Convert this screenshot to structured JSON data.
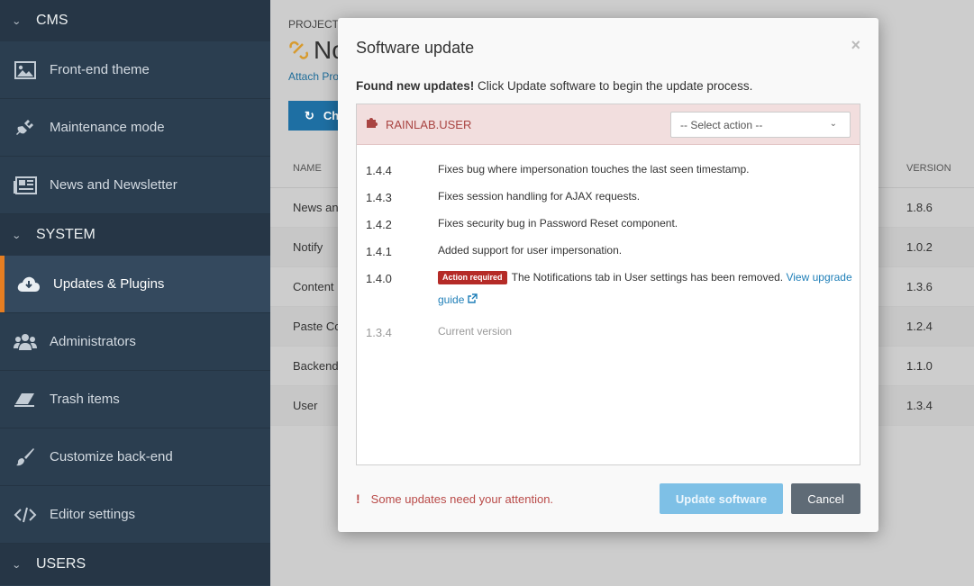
{
  "sidebar": {
    "sections": [
      {
        "title": "CMS"
      },
      {
        "title": "SYSTEM"
      },
      {
        "title": "USERS"
      }
    ],
    "items": [
      {
        "label": "Front-end theme",
        "icon": "picture-icon"
      },
      {
        "label": "Maintenance mode",
        "icon": "plug-icon"
      },
      {
        "label": "News and Newsletter",
        "icon": "newspaper-icon"
      },
      {
        "label": "Updates & Plugins",
        "icon": "cloud-download-icon"
      },
      {
        "label": "Administrators",
        "icon": "users-icon"
      },
      {
        "label": "Trash items",
        "icon": "eraser-icon"
      },
      {
        "label": "Customize back-end",
        "icon": "paint-brush-icon"
      },
      {
        "label": "Editor settings",
        "icon": "code-icon"
      }
    ]
  },
  "main": {
    "project_label": "PROJECT",
    "project_title_visible": "No",
    "attach_link": "Attach Pro",
    "check_button": "Ch",
    "table": {
      "headers": [
        "NAME",
        "VERSION"
      ],
      "rows": [
        {
          "name": "News an",
          "version": "1.8.6"
        },
        {
          "name": "Notify",
          "version": "1.0.2"
        },
        {
          "name": "Content",
          "version": "1.3.6"
        },
        {
          "name": "Paste Co",
          "version": "1.2.4"
        },
        {
          "name": "Backend",
          "version": "1.1.0"
        },
        {
          "name": "User",
          "version": "1.3.4"
        }
      ]
    }
  },
  "modal": {
    "title": "Software update",
    "close": "×",
    "found_bold": "Found new updates!",
    "found_rest": " Click Update software to begin the update process.",
    "plugin": {
      "name": "RAINLAB.USER",
      "select_value": "-- Select action --",
      "versions": [
        {
          "ver": "1.4.4",
          "desc": "Fixes bug where impersonation touches the last seen timestamp."
        },
        {
          "ver": "1.4.3",
          "desc": "Fixes session handling for AJAX requests."
        },
        {
          "ver": "1.4.2",
          "desc": "Fixes security bug in Password Reset component."
        },
        {
          "ver": "1.4.1",
          "desc": "Added support for user impersonation."
        },
        {
          "ver": "1.4.0",
          "badge": "Action required",
          "desc": " The Notifications tab in User settings has been removed. ",
          "link": "View upgrade guide"
        },
        {
          "ver": "1.3.4",
          "desc": "Current version"
        }
      ]
    },
    "attention": "Some updates need your attention.",
    "attention_mark": "!",
    "update_button": "Update software",
    "cancel_button": "Cancel"
  },
  "colors": {
    "sidebar_bg": "#2b3e50",
    "accent": "#e67e22",
    "danger": "#a94442",
    "link": "#1f7fb8"
  }
}
